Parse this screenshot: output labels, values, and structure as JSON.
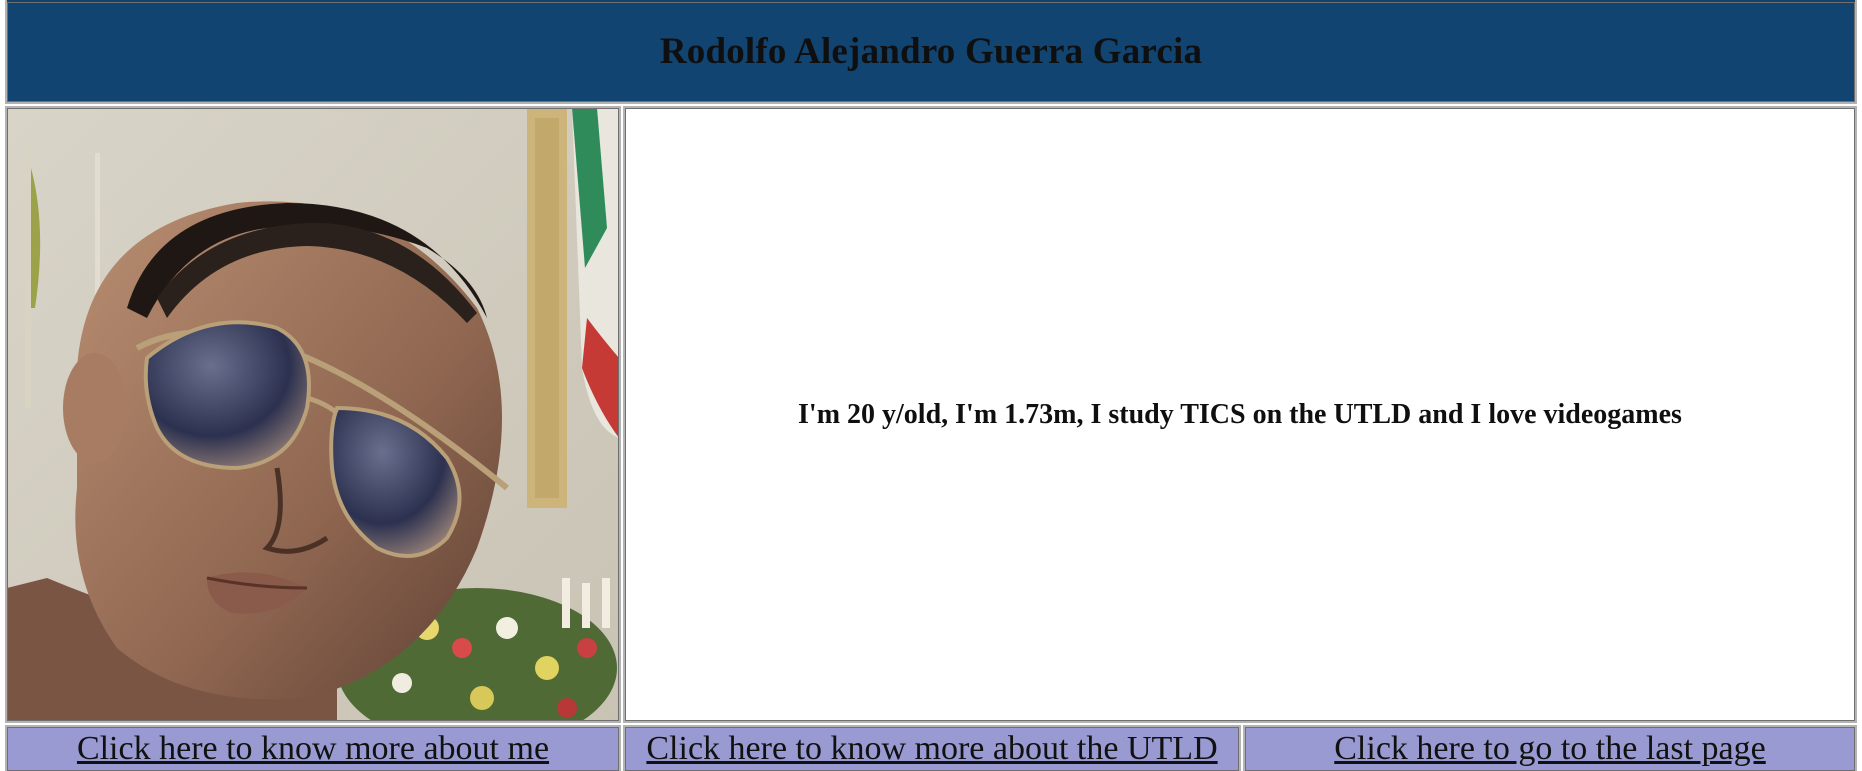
{
  "header": {
    "title": "Rodolfo Alejandro Guerra Garcia"
  },
  "profile": {
    "photo_icon": "portrait-photo-icon",
    "description": "I'm 20 y/old, I'm 1.73m, I study TICS on the UTLD and I love videogames"
  },
  "nav": {
    "links": [
      {
        "label": "Click here to know more about me"
      },
      {
        "label": "Click here to know more about the UTLD"
      },
      {
        "label": "Click here to go to the last page"
      }
    ]
  },
  "colors": {
    "header_bg": "#114470",
    "nav_bg": "#9a9ad3",
    "body_bg": "#ffffff"
  }
}
